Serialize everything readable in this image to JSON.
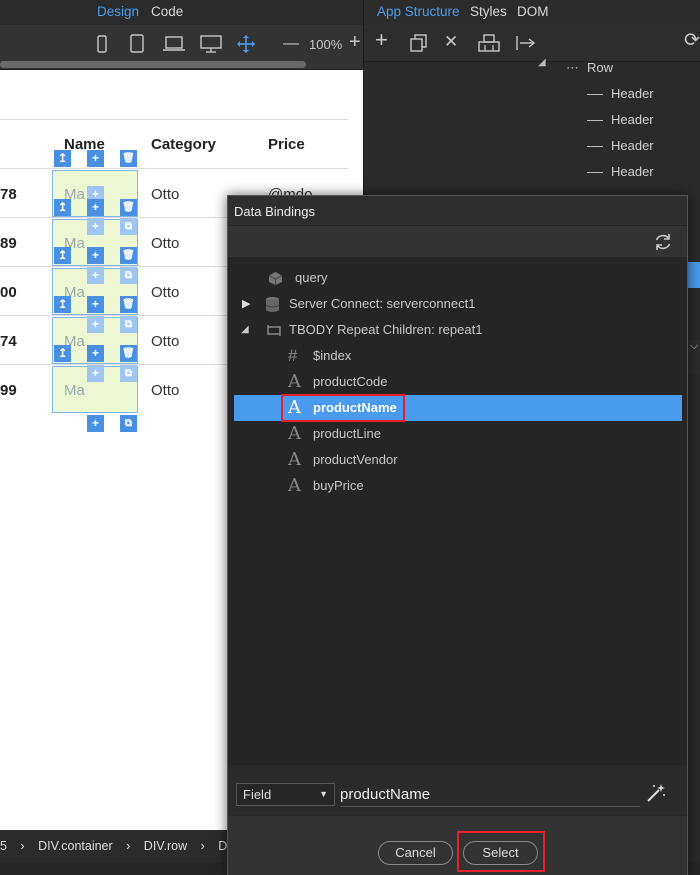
{
  "left_tabs": {
    "design": "Design",
    "code": "Code"
  },
  "left_toolbar": {
    "zoom": "100%"
  },
  "right_tabs": {
    "app_structure": "App Structure",
    "styles": "Styles",
    "dom": "DOM"
  },
  "structure_tree": {
    "row": "Row",
    "headers": [
      "Header",
      "Header",
      "Header",
      "Header"
    ]
  },
  "table": {
    "headers": {
      "name": "Name",
      "category": "Category",
      "price": "Price"
    },
    "rows": [
      {
        "num": "78",
        "name": "Ma",
        "category": "Otto"
      },
      {
        "num": "89",
        "name": "Ma",
        "category": "Otto"
      },
      {
        "num": "00",
        "name": "Ma",
        "category": "Otto"
      },
      {
        "num": "74",
        "name": "Ma",
        "category": "Otto"
      },
      {
        "num": "99",
        "name": "Ma",
        "category": "Otto"
      }
    ],
    "peek_text": "@mdo"
  },
  "breadcrumb": [
    "5",
    "DIV.container",
    "DIV.row",
    "DIV.c"
  ],
  "dialog": {
    "title": "Data Bindings",
    "nodes": [
      {
        "label": "query",
        "icon": "cube-icon"
      },
      {
        "label": "Server Connect: serverconnect1",
        "icon": "database-icon"
      },
      {
        "label": "TBODY Repeat Children: repeat1",
        "icon": "repeat-icon"
      },
      {
        "label": "$index",
        "icon": "hash-icon"
      },
      {
        "label": "productCode",
        "icon": "text-icon"
      },
      {
        "label": "productName",
        "icon": "text-icon"
      },
      {
        "label": "productLine",
        "icon": "text-icon"
      },
      {
        "label": "productVendor",
        "icon": "text-icon"
      },
      {
        "label": "buyPrice",
        "icon": "text-icon"
      }
    ],
    "field_type": "Field",
    "field_value": "productName",
    "cancel_label": "Cancel",
    "select_label": "Select"
  },
  "colors": {
    "accent": "#4a9aef",
    "highlight_box": "#e8202a"
  }
}
